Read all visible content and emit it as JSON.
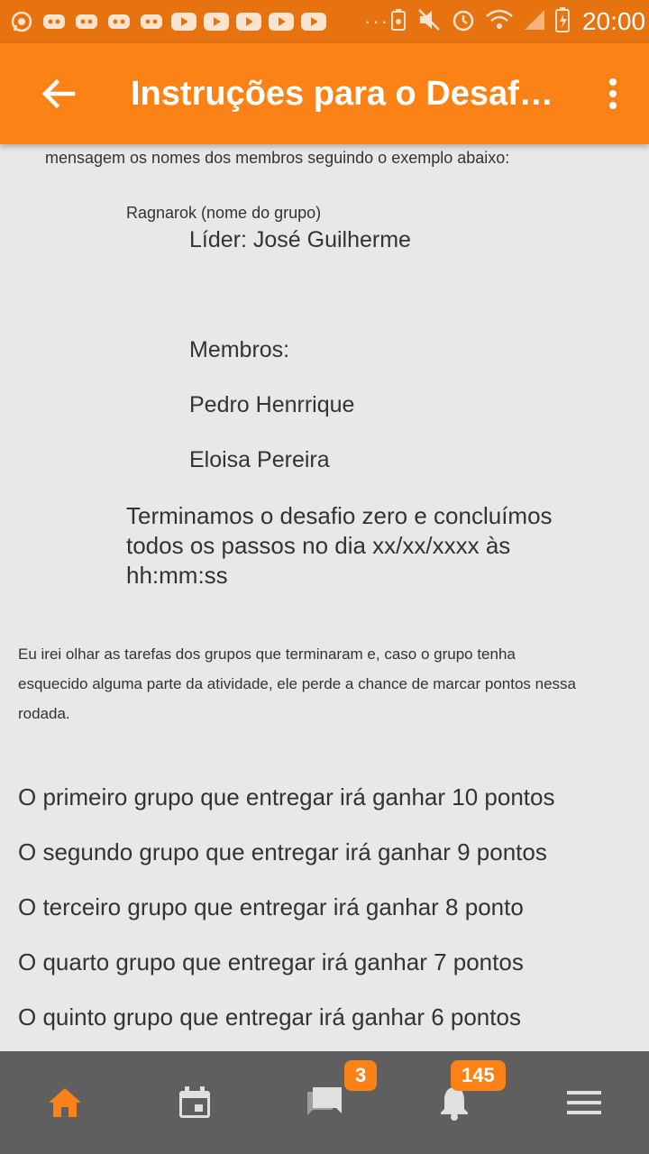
{
  "status_bar": {
    "time": "20:00",
    "dots": "···"
  },
  "toolbar": {
    "title": "Instruções para o Desafio Zero"
  },
  "content": {
    "line_top": "mensagem os nomes dos membros seguindo o exemplo abaixo:",
    "group_name": "Ragnarok (nome do grupo)",
    "leader": "Líder: José Guilherme",
    "members_label": "Membros:",
    "member_1": "Pedro Henrrique",
    "member_2": "Eloisa Pereira",
    "finish_line_1": "Terminamos o desafio zero e concluímos",
    "finish_line_2": "todos os passos no dia xx/xx/xxxx às",
    "finish_line_3": "hh:mm:ss",
    "note_line_1": "Eu irei olhar as tarefas dos grupos que terminaram e, caso o grupo tenha",
    "note_line_2": "esquecido alguma parte da atividade, ele perde a chance de marcar pontos nessa",
    "note_line_3": "rodada.",
    "points": [
      "O primeiro grupo que entregar irá ganhar 10 pontos",
      "O segundo grupo que entregar irá ganhar 9 pontos",
      "O terceiro grupo que entregar irá ganhar 8 ponto",
      "O quarto grupo que entregar irá ganhar 7 pontos",
      "O quinto grupo que entregar irá ganhar 6 pontos"
    ]
  },
  "bottom_nav": {
    "chats_badge": "3",
    "notifications_badge": "145"
  },
  "colors": {
    "accent": "#fb8216",
    "status_bar": "#e6730f",
    "nav_bg": "#5f5f5f",
    "content_bg": "#e8e8e8"
  }
}
